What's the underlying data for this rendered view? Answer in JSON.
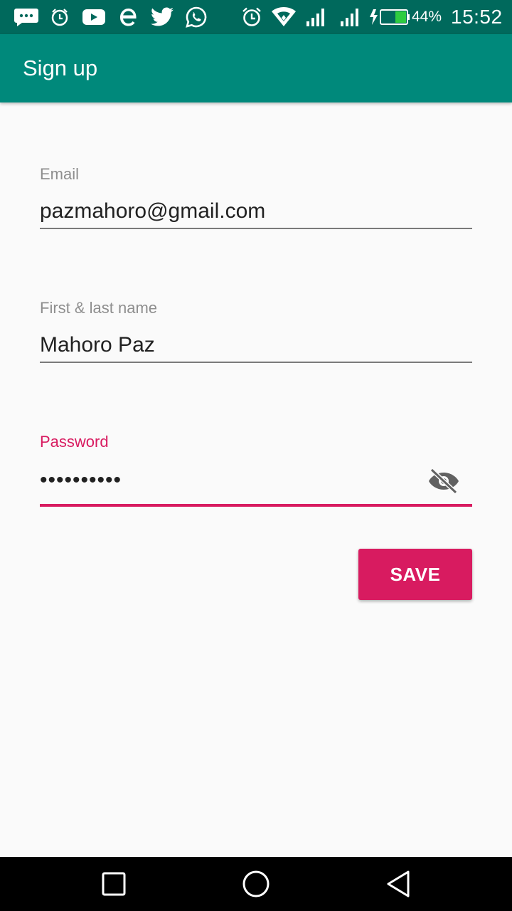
{
  "status_bar": {
    "notification_icons": [
      "messages-icon",
      "alarm-icon",
      "youtube-icon",
      "browser-icon",
      "twitter-icon",
      "whatsapp-icon"
    ],
    "system_icons": [
      "alarm-clock-icon",
      "wifi-icon",
      "signal-icon",
      "signal-icon",
      "battery-charging-icon"
    ],
    "battery_percent": "44%",
    "battery_level": 0.44,
    "time": "15:52"
  },
  "app_bar": {
    "title": "Sign up"
  },
  "form": {
    "email": {
      "label": "Email",
      "value": "pazmahoro@gmail.com"
    },
    "name": {
      "label": "First & last name",
      "value": "Mahoro Paz"
    },
    "password": {
      "label": "Password",
      "value": "••••••••••",
      "visibility_icon": "visibility-off-icon"
    },
    "save_label": "SAVE"
  },
  "nav_bar": {
    "buttons": [
      "recents-icon",
      "home-icon",
      "back-icon"
    ]
  },
  "colors": {
    "status_bar": "#00695c",
    "app_bar": "#00897b",
    "accent": "#d81b60",
    "background": "#fafafa"
  }
}
